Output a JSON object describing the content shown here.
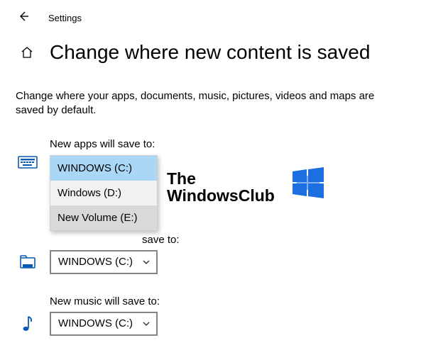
{
  "topbar": {
    "title": "Settings"
  },
  "header": {
    "title": "Change where new content is saved"
  },
  "description": "Change where your apps, documents, music, pictures, videos and maps are saved by default.",
  "sections": {
    "apps": {
      "label": "New apps will save to:",
      "value": "WINDOWS (C:)",
      "options": [
        "WINDOWS (C:)",
        "Windows (D:)",
        "New Volume (E:)"
      ]
    },
    "documents": {
      "label_fragment": "save to:",
      "value": "WINDOWS (C:)"
    },
    "music": {
      "label": "New music will save to:",
      "value": "WINDOWS (C:)"
    }
  },
  "watermark": {
    "line1": "The",
    "line2": "WindowsClub"
  }
}
